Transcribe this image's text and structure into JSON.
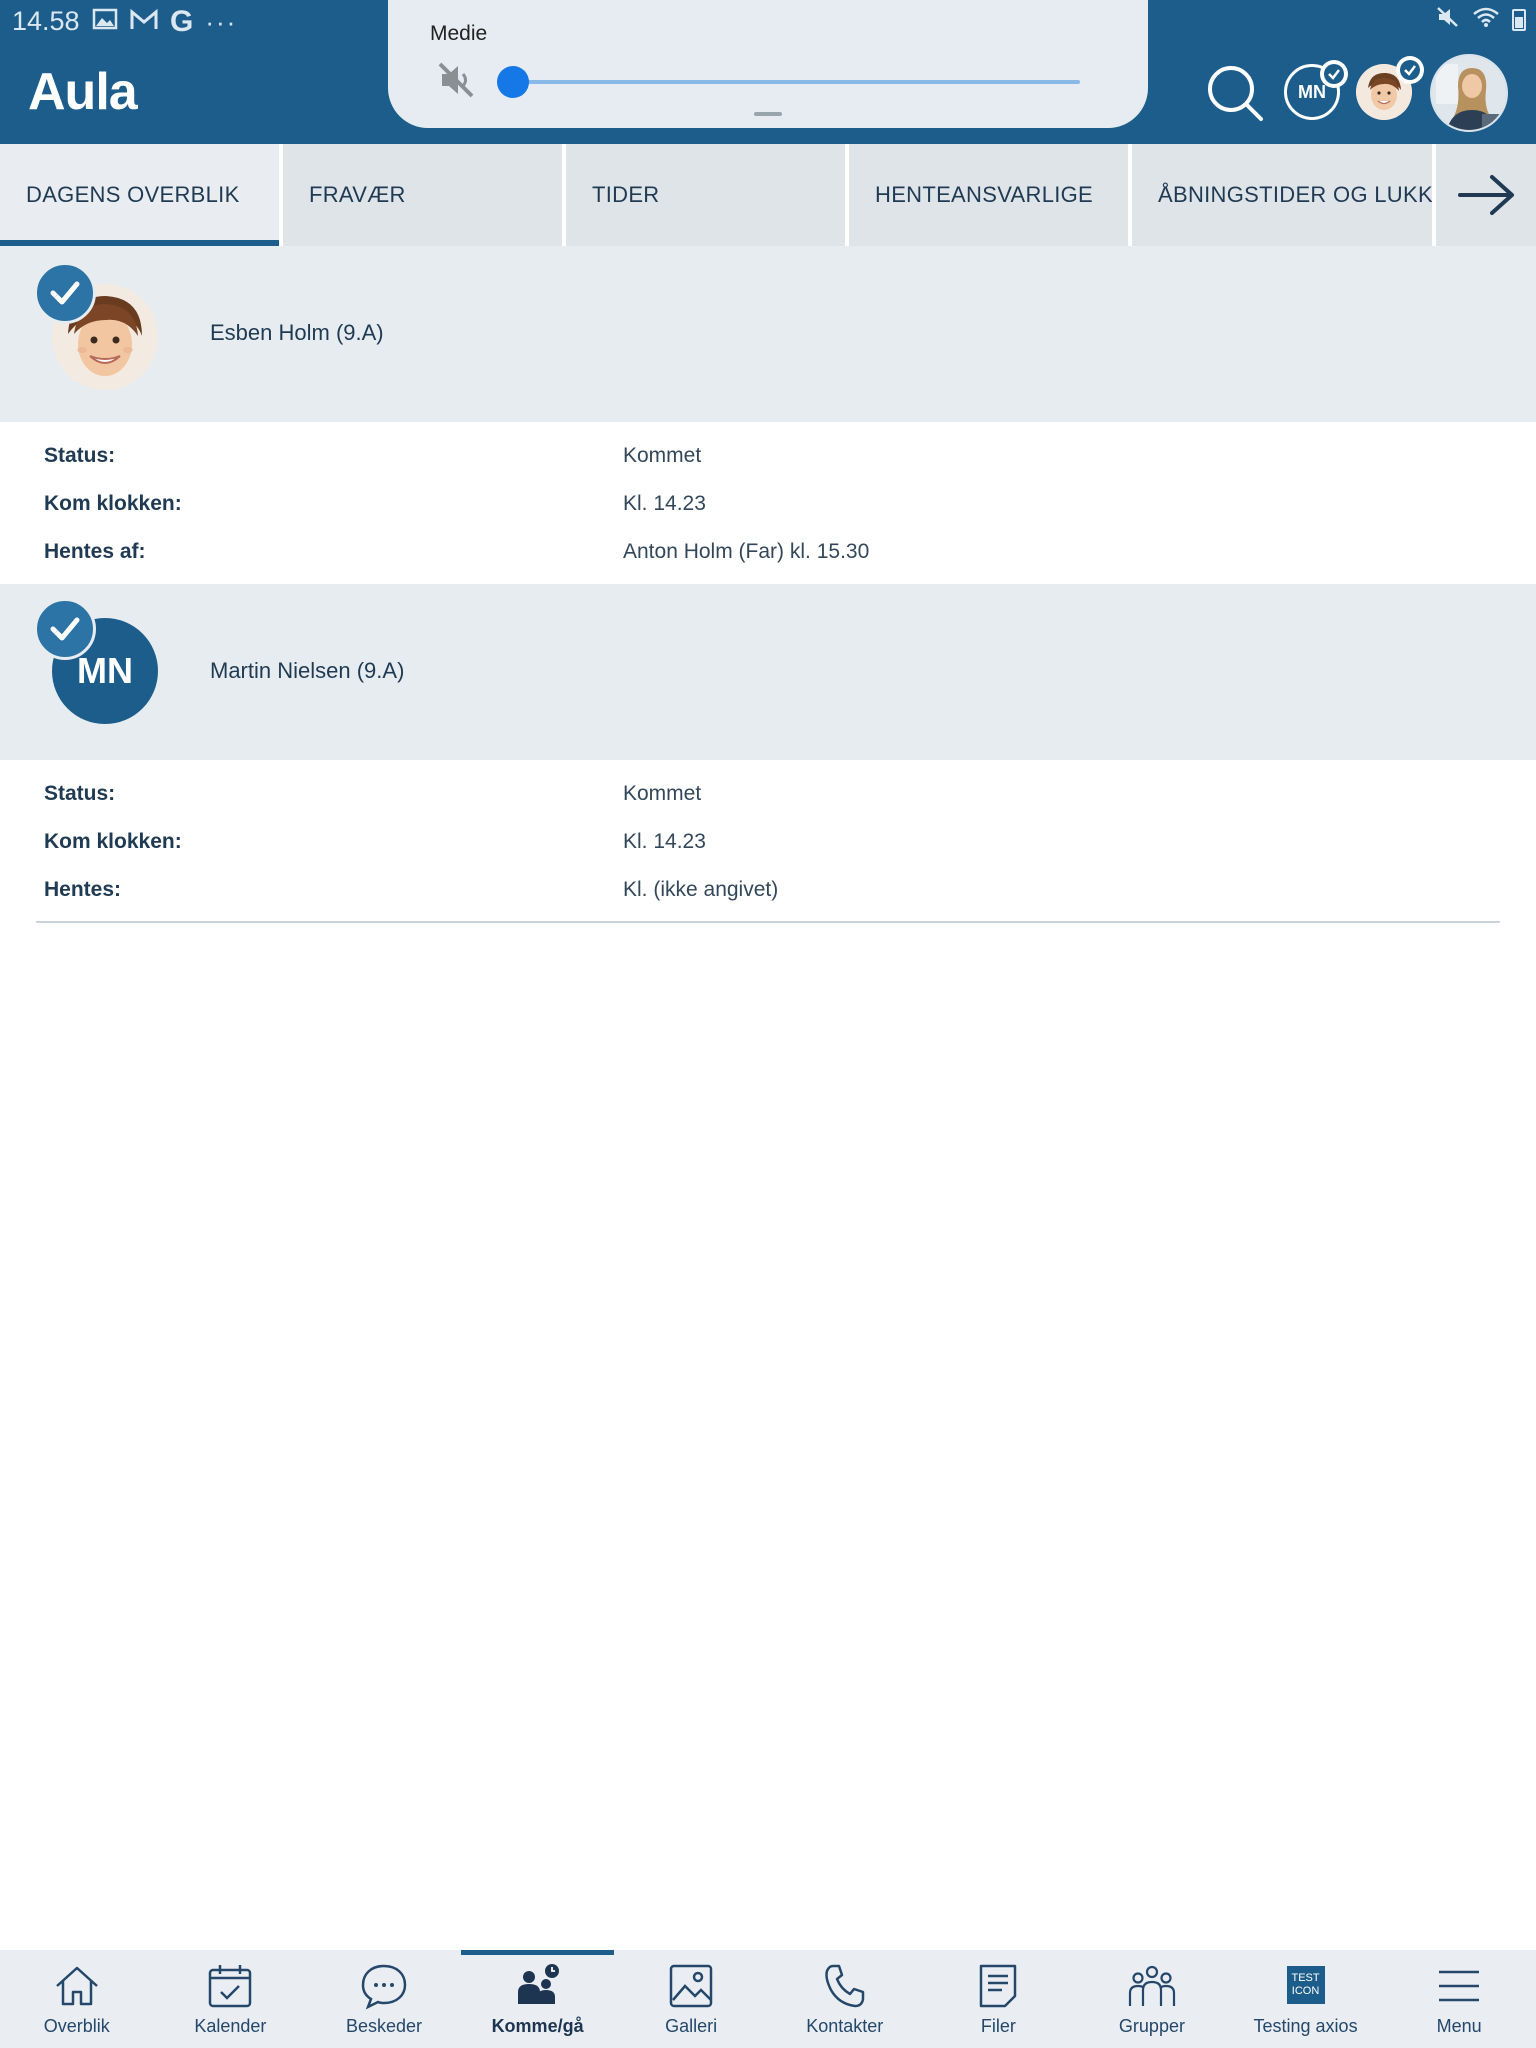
{
  "status_bar": {
    "time": "14.58",
    "left_icons": [
      "image-icon",
      "gmail-icon",
      "google-icon",
      "more-icon"
    ],
    "right_icons": [
      "mute-icon",
      "wifi-icon",
      "battery-icon"
    ]
  },
  "app": {
    "name": "Aula"
  },
  "media_panel": {
    "label": "Medie",
    "volume": 0
  },
  "header": {
    "avatars": [
      {
        "name": "mn-avatar",
        "initials": "MN",
        "checked": true
      },
      {
        "name": "esben-avatar",
        "checked": true
      },
      {
        "name": "profile-avatar"
      }
    ]
  },
  "tabs": [
    {
      "label": "DAGENS OVERBLIK",
      "active": true
    },
    {
      "label": "FRAVÆR",
      "active": false
    },
    {
      "label": "TIDER",
      "active": false
    },
    {
      "label": "HENTEANSVARLIGE",
      "active": false
    },
    {
      "label": "ÅBNINGSTIDER OG LUKKE",
      "active": false
    }
  ],
  "children": [
    {
      "name": "Esben Holm (9.A)",
      "rows": [
        {
          "label": "Status:",
          "value": "Kommet"
        },
        {
          "label": "Kom klokken:",
          "value": "Kl. 14.23"
        },
        {
          "label": "Hentes af:",
          "value": "Anton Holm (Far) kl. 15.30"
        }
      ]
    },
    {
      "name": "Martin Nielsen (9.A)",
      "initials": "MN",
      "rows": [
        {
          "label": "Status:",
          "value": "Kommet"
        },
        {
          "label": "Kom klokken:",
          "value": "Kl. 14.23"
        },
        {
          "label": "Hentes:",
          "value": "Kl. (ikke angivet)"
        }
      ]
    }
  ],
  "bottom_nav": [
    {
      "label": "Overblik",
      "icon": "home-icon"
    },
    {
      "label": "Kalender",
      "icon": "calendar-icon"
    },
    {
      "label": "Beskeder",
      "icon": "messages-icon"
    },
    {
      "label": "Komme/gå",
      "icon": "comego-icon",
      "active": true
    },
    {
      "label": "Galleri",
      "icon": "gallery-icon"
    },
    {
      "label": "Kontakter",
      "icon": "phone-icon"
    },
    {
      "label": "Filer",
      "icon": "files-icon"
    },
    {
      "label": "Grupper",
      "icon": "groups-icon"
    },
    {
      "label": "Testing axios",
      "icon": "test-icon",
      "icon_text": [
        "TEST",
        "ICON"
      ]
    },
    {
      "label": "Menu",
      "icon": "menu-icon"
    }
  ],
  "colors": {
    "primary": "#1d5d8b",
    "panel": "#e7ecf0",
    "tab_bg": "#dfe4e9",
    "media_knob": "#1578e6"
  }
}
